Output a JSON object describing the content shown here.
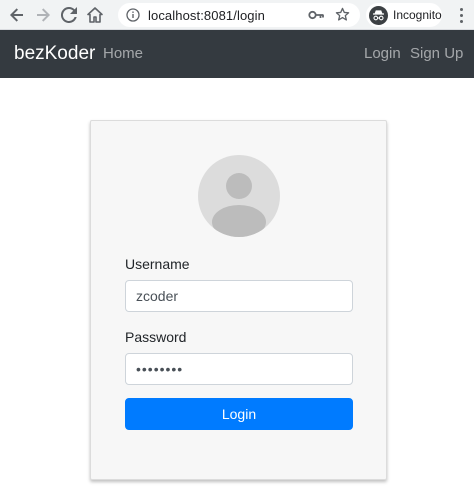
{
  "browser": {
    "url": "localhost:8081/login",
    "incognito_label": "Incognito",
    "icons": [
      "back-arrow-icon",
      "forward-arrow-icon",
      "reload-icon",
      "home-icon",
      "info-icon",
      "key-icon",
      "star-icon",
      "incognito-icon",
      "kebab-menu-icon"
    ]
  },
  "navbar": {
    "brand": "bezKoder",
    "home_label": "Home",
    "login_label": "Login",
    "signup_label": "Sign Up",
    "background": "#343a40"
  },
  "form": {
    "username_label": "Username",
    "username_value": "zcoder",
    "password_label": "Password",
    "password_value": "12345678",
    "submit_label": "Login",
    "accent": "#007bff",
    "avatar_icon": "user-avatar-icon"
  }
}
